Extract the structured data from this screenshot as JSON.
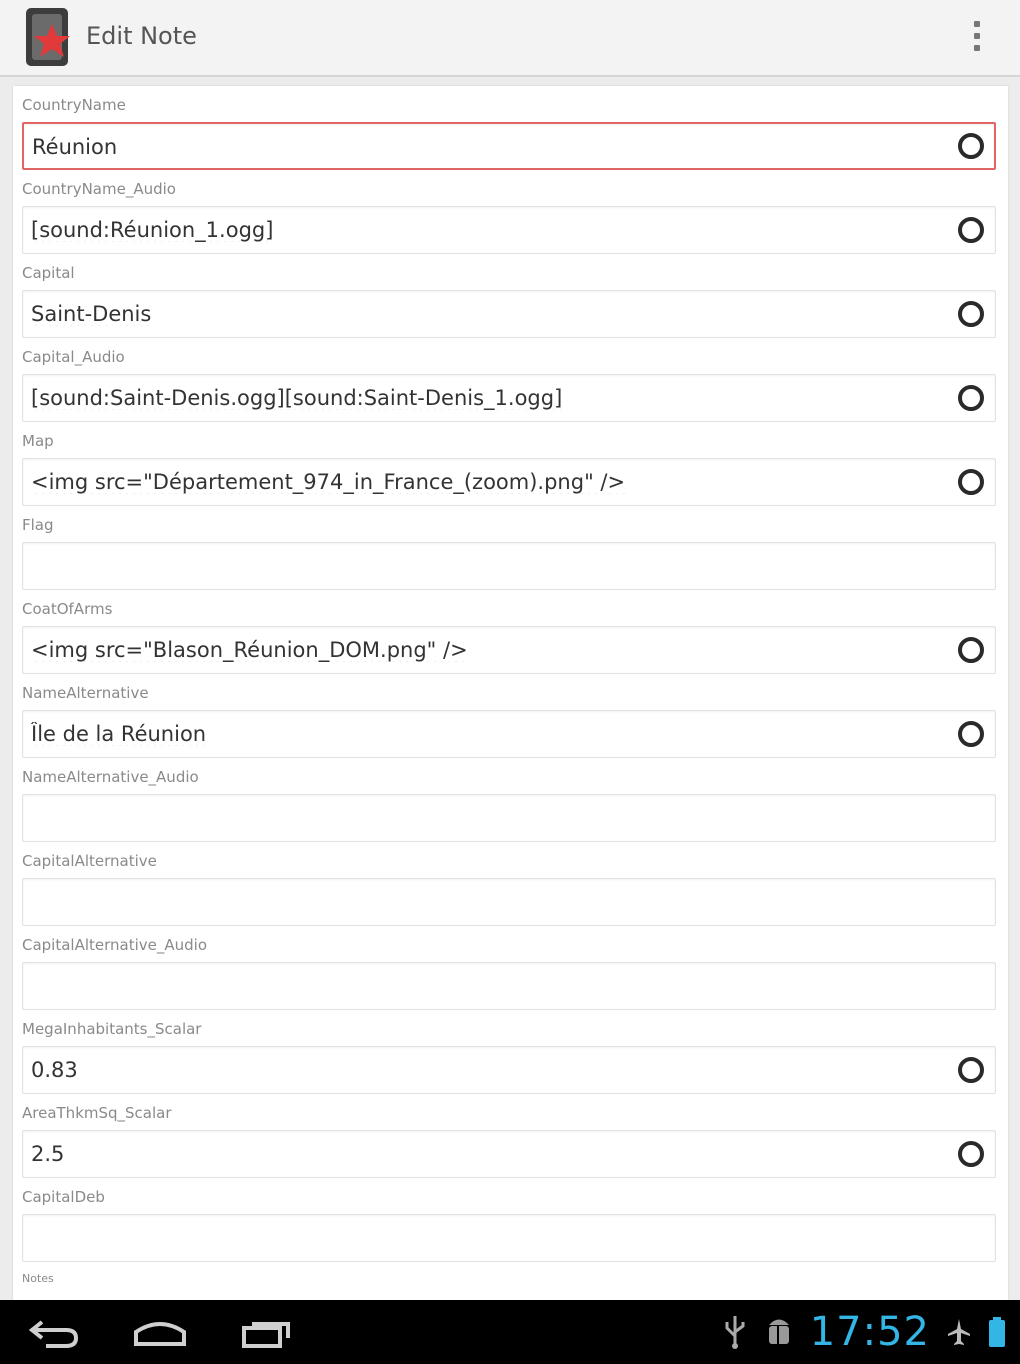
{
  "app": {
    "title": "Edit Note",
    "icon": "anki-app-icon",
    "menu_icon": "overflow-menu-icon"
  },
  "fields": [
    {
      "label": "CountryName",
      "value": "Réunion",
      "focused": true,
      "sticky_icon": true
    },
    {
      "label": "CountryName_Audio",
      "value": "[sound:Réunion_1.ogg]",
      "focused": false,
      "sticky_icon": true
    },
    {
      "label": "Capital",
      "value": "Saint-Denis",
      "focused": false,
      "sticky_icon": true
    },
    {
      "label": "Capital_Audio",
      "value": "[sound:Saint-Denis.ogg][sound:Saint-Denis_1.ogg]",
      "focused": false,
      "sticky_icon": true
    },
    {
      "label": "Map",
      "value": "<img src=\"Département_974_in_France_(zoom).png\" />",
      "focused": false,
      "sticky_icon": true
    },
    {
      "label": "Flag",
      "value": "",
      "focused": false,
      "sticky_icon": false
    },
    {
      "label": "CoatOfArms",
      "value": "<img src=\"Blason_Réunion_DOM.png\" />",
      "focused": false,
      "sticky_icon": true
    },
    {
      "label": "NameAlternative",
      "value": "Île de la Réunion",
      "focused": false,
      "sticky_icon": true
    },
    {
      "label": "NameAlternative_Audio",
      "value": "",
      "focused": false,
      "sticky_icon": false
    },
    {
      "label": "CapitalAlternative",
      "value": "",
      "focused": false,
      "sticky_icon": false
    },
    {
      "label": "CapitalAlternative_Audio",
      "value": "",
      "focused": false,
      "sticky_icon": false
    },
    {
      "label": "MegaInhabitants_Scalar",
      "value": "0.83",
      "focused": false,
      "sticky_icon": true
    },
    {
      "label": "AreaThkmSq_Scalar",
      "value": "2.5",
      "focused": false,
      "sticky_icon": true
    },
    {
      "label": "CapitalDeb",
      "value": "",
      "focused": false,
      "sticky_icon": false
    },
    {
      "label": "Notes",
      "value": "",
      "focused": false,
      "sticky_icon": false
    }
  ],
  "navbar": {
    "back_icon": "back-icon",
    "home_icon": "home-icon",
    "recents_icon": "recent-apps-icon",
    "usb_icon": "usb-icon",
    "android_debug_icon": "android-debug-icon",
    "time": "17:52",
    "airplane_icon": "airplane-mode-icon",
    "battery_icon": "battery-icon",
    "clock_color": "#33b5e5"
  }
}
